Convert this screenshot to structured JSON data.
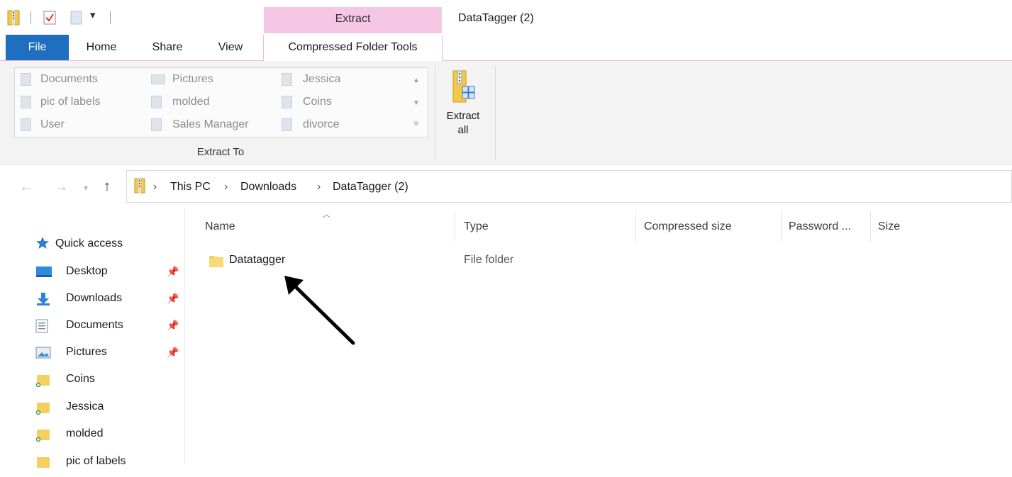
{
  "titlebar": {
    "context_tab": "Extract",
    "window_title": "DataTagger (2)"
  },
  "ribbon_tabs": {
    "file": "File",
    "home": "Home",
    "share": "Share",
    "view": "View",
    "compressed_folder_tools": "Compressed Folder Tools"
  },
  "extract_to": {
    "group_label": "Extract To",
    "destinations": [
      {
        "label": "Documents"
      },
      {
        "label": "pic of labels"
      },
      {
        "label": "User"
      },
      {
        "label": "Pictures"
      },
      {
        "label": "molded"
      },
      {
        "label": "Sales Manager"
      },
      {
        "label": "Jessica"
      },
      {
        "label": "Coins"
      },
      {
        "label": "divorce"
      }
    ]
  },
  "extract_all": {
    "line1": "Extract",
    "line2": "all"
  },
  "address": {
    "crumbs": [
      "This PC",
      "Downloads",
      "DataTagger (2)"
    ],
    "separator": "›"
  },
  "nav": {
    "quick_access": "Quick access",
    "items": [
      {
        "label": "Desktop",
        "icon": "desktop-icon",
        "pinned": true
      },
      {
        "label": "Downloads",
        "icon": "downloads-icon",
        "pinned": true
      },
      {
        "label": "Documents",
        "icon": "documents-icon",
        "pinned": true
      },
      {
        "label": "Pictures",
        "icon": "pictures-icon",
        "pinned": true
      },
      {
        "label": "Coins",
        "icon": "folder-icon",
        "pinned": false
      },
      {
        "label": "Jessica",
        "icon": "folder-icon",
        "pinned": false
      },
      {
        "label": "molded",
        "icon": "folder-icon",
        "pinned": false
      },
      {
        "label": "pic of labels",
        "icon": "folder-icon",
        "pinned": false
      }
    ]
  },
  "columns": {
    "name": "Name",
    "type": "Type",
    "compressed_size": "Compressed size",
    "password": "Password ...",
    "size": "Size"
  },
  "files": [
    {
      "name": "Datatagger",
      "type": "File folder"
    }
  ],
  "colors": {
    "file_tab": "#1e6fc0",
    "context_tab": "#f6c7e4",
    "folder": "#f5d060"
  }
}
